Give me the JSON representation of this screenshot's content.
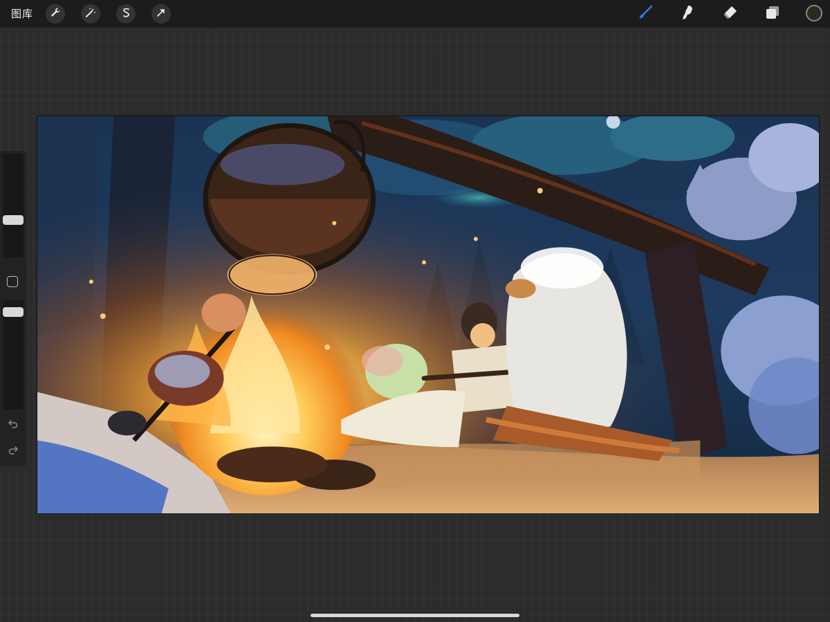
{
  "toolbar": {
    "gallery_label": "图库",
    "left_tools": [
      {
        "icon": "wrench-icon",
        "name": "actions"
      },
      {
        "icon": "magic-wand-icon",
        "name": "adjustments"
      },
      {
        "icon": "selection-s-icon",
        "name": "selection"
      },
      {
        "icon": "arrow-cursor-icon",
        "name": "transform"
      }
    ],
    "right_tools": [
      {
        "icon": "brush-icon",
        "name": "paint",
        "active": true
      },
      {
        "icon": "smudge-icon",
        "name": "smudge"
      },
      {
        "icon": "eraser-icon",
        "name": "eraser"
      },
      {
        "icon": "layers-icon",
        "name": "layers"
      }
    ],
    "active_color": "#2b2a1f",
    "accent_color": "#2f7bf5"
  },
  "sidebar": {
    "brush_size": 0.55,
    "brush_opacity": 0.95,
    "icons": [
      "square-modifier-icon",
      "undo-icon",
      "redo-icon"
    ]
  },
  "canvas": {
    "content": "painting"
  }
}
